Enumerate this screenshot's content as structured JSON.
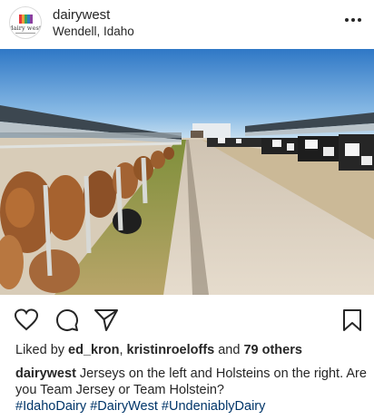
{
  "post": {
    "username": "dairywest",
    "location": "Wendell, Idaho",
    "avatar": {
      "logo_text": "dairy west",
      "flag_colors": [
        "#e4373f",
        "#f2a23b",
        "#3aa65b",
        "#2b7fc2",
        "#8b3fa0"
      ]
    },
    "menu_icon": "more-dots-icon"
  },
  "actions": {
    "like_icon": "heart-icon",
    "comment_icon": "comment-icon",
    "share_icon": "send-icon",
    "save_icon": "bookmark-icon"
  },
  "likes": {
    "prefix": "Liked by ",
    "user1": "ed_kron",
    "separator": ", ",
    "user2": "kristinroeloffs",
    "conjunction": " and ",
    "others": "79 others"
  },
  "caption": {
    "username": "dairywest",
    "text": " Jerseys on the left and Holsteins on the right. Are you Team Jersey or Team Holstein?",
    "hashtags": [
      "#IdahoDairy",
      "#DairyWest",
      "#UndeniablyDairy"
    ]
  },
  "colors": {
    "text": "#262626",
    "hashtag": "#003569",
    "sky_top": "#2f78c6",
    "sky_bottom": "#c9dff0"
  }
}
